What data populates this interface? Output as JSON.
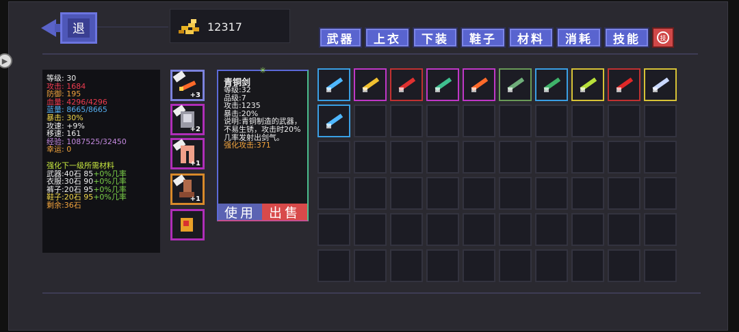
{
  "back_button": {
    "label": "退"
  },
  "gold": {
    "value": "12317"
  },
  "tabs": [
    {
      "label": "武器"
    },
    {
      "label": "上衣"
    },
    {
      "label": "下装"
    },
    {
      "label": "鞋子"
    },
    {
      "label": "材料"
    },
    {
      "label": "消耗"
    },
    {
      "label": "技能"
    }
  ],
  "skill_button": {
    "label": "技"
  },
  "stats": {
    "level": "等级: 30",
    "attack": "攻击: 1684",
    "defense": "防御: 195",
    "hp": "血量: 4296/4296",
    "mp": "蓝量: 8665/8665",
    "crit": "暴击: 30%",
    "attack_speed": "攻速: +9%",
    "move_speed": "移速: 161",
    "exp": "经验: 1087525/32450",
    "luck": "幸运: 0",
    "upgrade_title": "强化下一级所需材料",
    "weapon_prefix": "武器:40石 85",
    "weapon_rate": "+0%几率",
    "clothes_prefix": "衣服:30石 90",
    "clothes_rate": "+0%几率",
    "pants_prefix": "裤子:20石 95",
    "pants_rate": "+0%几率",
    "shoes_prefix": "鞋子:20石 95",
    "shoes_rate": "+0%几率",
    "remaining": "剩余:36石"
  },
  "equipment": [
    {
      "level": "+3",
      "icon": "flame-sword-icon"
    },
    {
      "level": "+2",
      "icon": "armor-icon"
    },
    {
      "level": "+1",
      "icon": "pants-icon"
    },
    {
      "level": "+1",
      "icon": "boots-icon"
    },
    {
      "level": "",
      "icon": "pet-icon"
    }
  ],
  "item_detail": {
    "name": "青铜剑",
    "level": "等级:32",
    "grade": "品级:7",
    "attack": "攻击:1235",
    "crit": "暴击:20%",
    "description": "说明:青铜制造的武器，不易生锈，攻击时20%几率发射出剑气。",
    "enhanced_attack": "强化攻击:371",
    "use_label": "使用",
    "sell_label": "出售"
  },
  "inventory": [
    {
      "icon": "ice-sword-icon",
      "rarity": "blue",
      "color": "#4fb7ff"
    },
    {
      "icon": "golden-bow-icon",
      "rarity": "purple",
      "color": "#f0c030"
    },
    {
      "icon": "red-katana-icon",
      "rarity": "red",
      "color": "#e03030"
    },
    {
      "icon": "emerald-staff-icon",
      "rarity": "purple",
      "color": "#3fbf8f"
    },
    {
      "icon": "flame-sword-icon",
      "rarity": "purple",
      "color": "#ff6a2a"
    },
    {
      "icon": "bronze-sword-icon",
      "rarity": "green",
      "color": "#6fae7a"
    },
    {
      "icon": "jade-sword-icon",
      "rarity": "blue",
      "color": "#3fb36a"
    },
    {
      "icon": "crossbow-icon",
      "rarity": "yellow",
      "color": "#b8e03a"
    },
    {
      "icon": "crimson-blade-icon",
      "rarity": "red",
      "color": "#e02828"
    },
    {
      "icon": "silver-sword-icon",
      "rarity": "yellow",
      "color": "#c9d8ff"
    },
    {
      "icon": "ice-sword-icon",
      "rarity": "blue",
      "color": "#4fb7ff"
    }
  ]
}
